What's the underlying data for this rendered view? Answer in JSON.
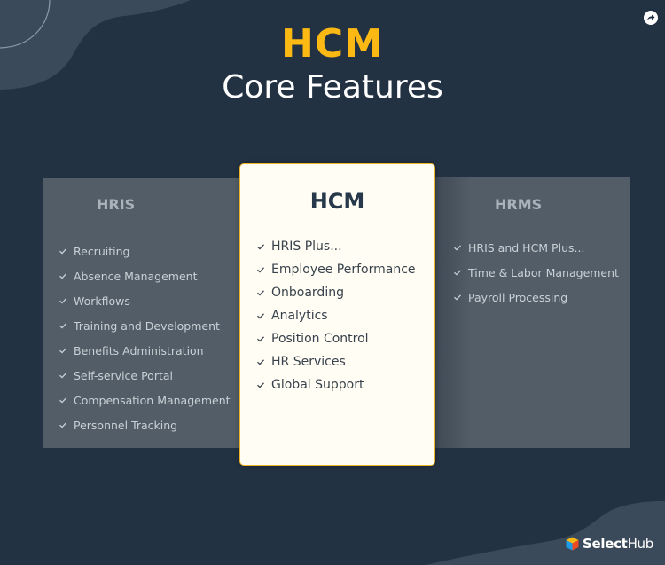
{
  "header": {
    "title": "HCM",
    "subtitle": "Core Features"
  },
  "colors": {
    "background": "#233243",
    "accent": "#fdb913",
    "panel": "#525d67",
    "card": "#fffdf4"
  },
  "panels": {
    "hris": {
      "title": "HRIS",
      "items": [
        "Recruiting",
        "Absence Management",
        "Workflows",
        "Training and Development",
        "Benefits Administration",
        "Self-service Portal",
        "Compensation Management",
        "Personnel Tracking"
      ]
    },
    "hcm": {
      "title": "HCM",
      "items": [
        "HRIS Plus...",
        "Employee Performance",
        "Onboarding",
        "Analytics",
        "Position Control",
        "HR Services",
        "Global Support"
      ]
    },
    "hrms": {
      "title": "HRMS",
      "items": [
        "HRIS and HCM Plus...",
        "Time & Labor Management",
        "Payroll Processing"
      ]
    }
  },
  "icons": {
    "share": "share-icon",
    "check": "check-icon"
  },
  "brand": {
    "name_bold": "Select",
    "name_regular": "Hub"
  }
}
